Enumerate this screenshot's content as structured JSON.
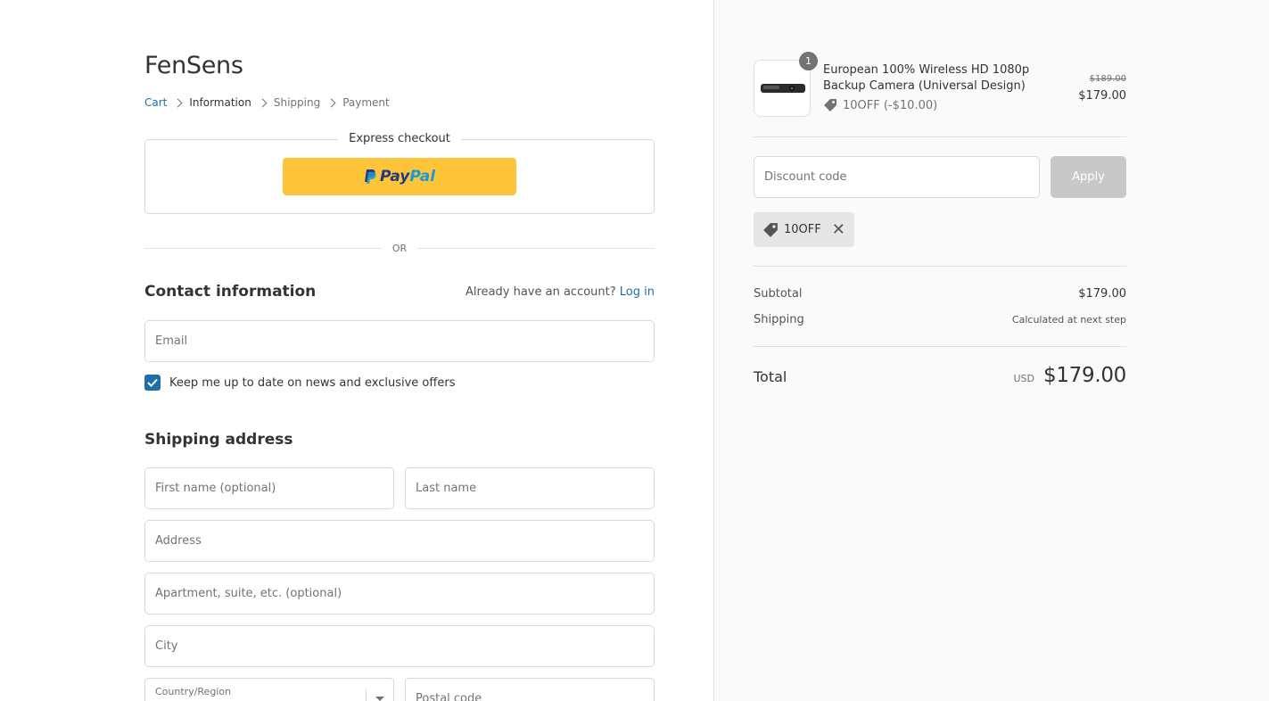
{
  "store": {
    "name": "FenSens"
  },
  "breadcrumb": {
    "cart": "Cart",
    "information": "Information",
    "shipping": "Shipping",
    "payment": "Payment"
  },
  "express": {
    "title": "Express checkout",
    "paypal_pay": "Pay",
    "paypal_pal": "Pal"
  },
  "or_label": "OR",
  "contact": {
    "title": "Contact information",
    "account_prompt": "Already have an account?",
    "login_label": "Log in",
    "email_placeholder": "Email",
    "newsletter_label": "Keep me up to date on news and exclusive offers",
    "newsletter_checked": true
  },
  "shipping_address": {
    "title": "Shipping address",
    "first_name_placeholder": "First name (optional)",
    "last_name_placeholder": "Last name",
    "address_placeholder": "Address",
    "apartment_placeholder": "Apartment, suite, etc. (optional)",
    "city_placeholder": "City",
    "country_label": "Country/Region",
    "postal_placeholder": "Postal code"
  },
  "order": {
    "item": {
      "quantity": "1",
      "name": "European 100% Wireless HD 1080p Backup Camera (Universal Design)",
      "discount": "10OFF (-$10.00)",
      "price_original": "$189.00",
      "price_final": "$179.00"
    },
    "discount_placeholder": "Discount code",
    "apply_label": "Apply",
    "applied_code": "10OFF",
    "subtotal_label": "Subtotal",
    "subtotal_value": "$179.00",
    "shipping_label": "Shipping",
    "shipping_value": "Calculated at next step",
    "total_label": "Total",
    "currency": "USD",
    "total_value": "$179.00"
  },
  "colors": {
    "accent": "#1e6fa8",
    "paypal_yellow": "#ffc439",
    "sidebar_bg": "#fafafa"
  }
}
